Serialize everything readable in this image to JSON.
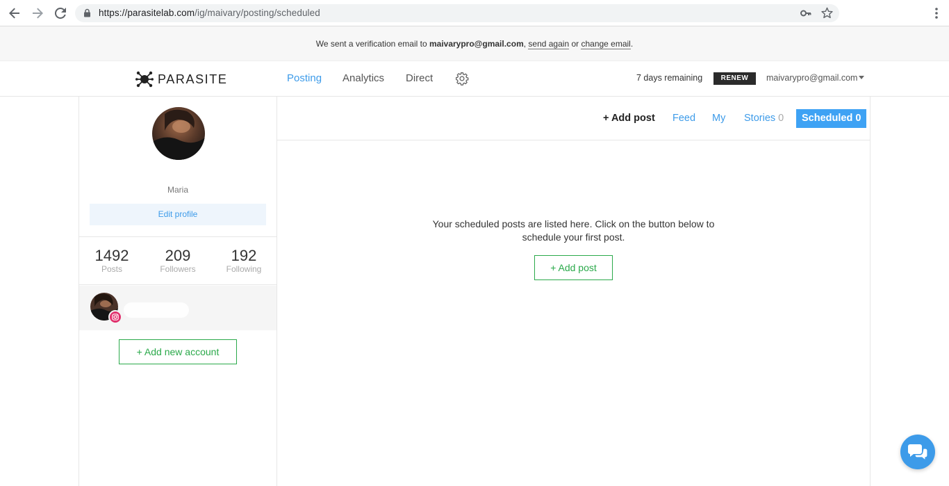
{
  "browser": {
    "url_host": "https://parasitelab.com",
    "url_path": "/ig/maivary/posting/scheduled"
  },
  "banner": {
    "prefix": "We sent a verification email to ",
    "email": "maivarypro@gmail.com",
    "comma": ", ",
    "send_again": "send again",
    "or": " or ",
    "change_email": "change email",
    "suffix": "."
  },
  "topnav": {
    "logo_text": "PARASITE",
    "links": [
      "Posting",
      "Analytics",
      "Direct"
    ],
    "active_link": "Posting",
    "days_remaining": "7 days remaining",
    "renew_label": "RENEW",
    "account_email": "maivarypro@gmail.com"
  },
  "sidebar": {
    "profile_name": "Maria",
    "edit_profile": "Edit profile",
    "stats": [
      {
        "value": "1492",
        "label": "Posts"
      },
      {
        "value": "209",
        "label": "Followers"
      },
      {
        "value": "192",
        "label": "Following"
      }
    ],
    "add_account": "+ Add new account"
  },
  "main": {
    "tabs": {
      "add_post": "+ Add post",
      "feed": "Feed",
      "my": "My",
      "stories": "Stories",
      "stories_count": "0",
      "scheduled": "Scheduled 0"
    },
    "empty_line1": "Your scheduled posts are listed here. Click on the button below to schedule your first post.",
    "add_post_button": "+ Add post"
  },
  "colors": {
    "accent": "#3d9be9",
    "green": "#2aa94a",
    "instagram": "#e1306c"
  }
}
